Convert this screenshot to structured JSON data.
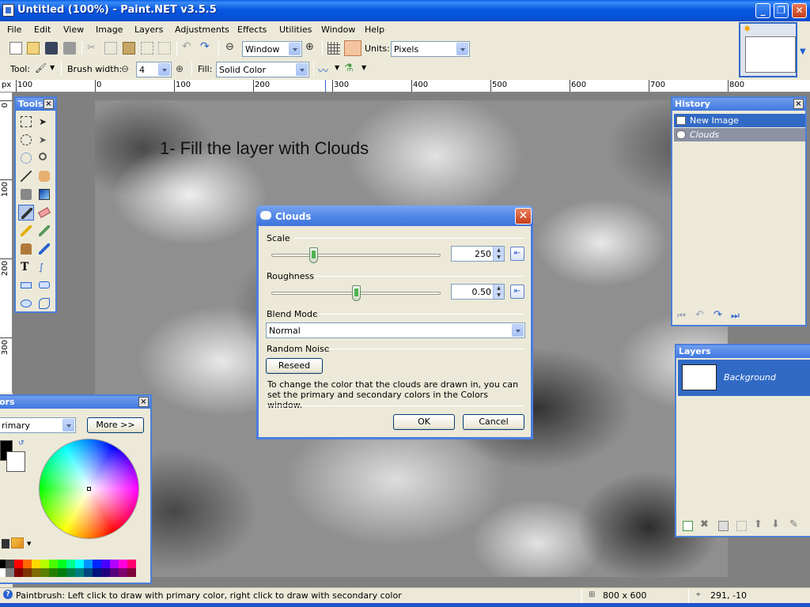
{
  "window": {
    "title": "Untitled (100%) - Paint.NET v3.5.5",
    "minimize_label": "_",
    "restore_label": "❐",
    "close_label": "✕"
  },
  "menu": {
    "items": [
      "File",
      "Edit",
      "View",
      "Image",
      "Layers",
      "Adjustments",
      "Effects",
      "Utilities",
      "Window",
      "Help"
    ]
  },
  "toolbar1": {
    "zoom_value": "Window",
    "units_label": "Units:",
    "units_value": "Pixels"
  },
  "toolbar2": {
    "tool_label": "Tool:",
    "brush_width_label": "Brush width:",
    "brush_width_value": "4",
    "fill_label": "Fill:",
    "fill_value": "Solid Color"
  },
  "ruler": {
    "unit": "px",
    "top_labels": [
      "100",
      "0",
      "100",
      "200",
      "300",
      "400",
      "500",
      "600",
      "700",
      "800"
    ],
    "left_labels": [
      "0",
      "100",
      "200",
      "300"
    ]
  },
  "canvas": {
    "caption": "1- Fill the layer with Clouds"
  },
  "tools_window": {
    "title": "Tools"
  },
  "history_window": {
    "title": "History",
    "items": [
      {
        "label": "New Image",
        "icon": "new-image-icon"
      },
      {
        "label": "Clouds",
        "icon": "clouds-icon"
      }
    ]
  },
  "layers_window": {
    "title": "Layers",
    "layers": [
      {
        "name": "Background"
      }
    ]
  },
  "colors_window": {
    "title": "ors",
    "mode_value": "rimary",
    "more_button": "More >>"
  },
  "dialog": {
    "title": "Clouds",
    "scale_label": "Scale",
    "scale_value": "250",
    "scale_position": 0.25,
    "roughness_label": "Roughness",
    "roughness_value": "0.50",
    "roughness_position": 0.5,
    "blend_mode_label": "Blend Mode",
    "blend_mode_value": "Normal",
    "random_noise_label": "Random Noise",
    "reseed_button": "Reseed",
    "help_text": "To change the color that the clouds are drawn in, you can set the primary and secondary colors in the Colors window.",
    "ok_button": "OK",
    "cancel_button": "Cancel"
  },
  "status": {
    "hint": "Paintbrush: Left click to draw with primary color, right click to draw with secondary color",
    "image_size": "800 x 600",
    "cursor_position": "291, -10"
  },
  "colors": {
    "accent": "#316AC5",
    "titlebar": "#0A5FE8",
    "face": "#ECE9D8"
  }
}
